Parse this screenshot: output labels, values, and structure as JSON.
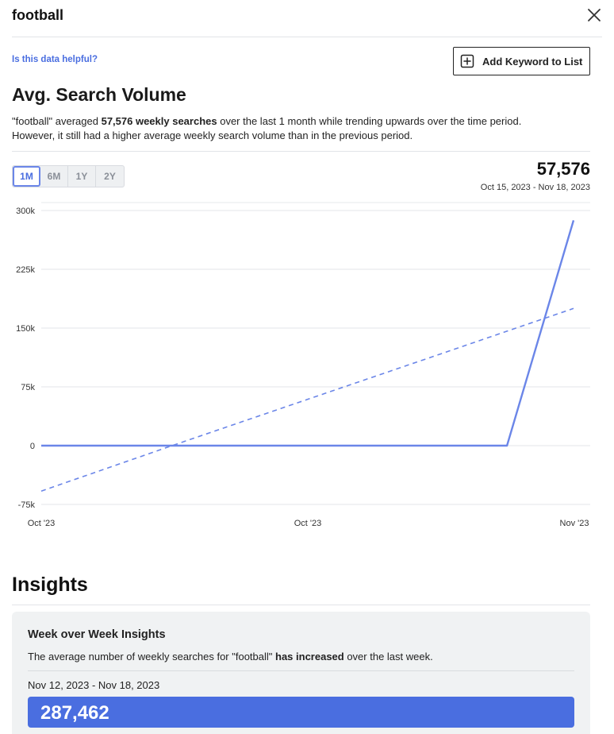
{
  "header": {
    "title": "football"
  },
  "actions": {
    "helpful_link": "Is this data helpful?",
    "add_keyword_label": "Add Keyword to List"
  },
  "volume": {
    "title": "Avg. Search Volume",
    "summary_pre": "\"football\" averaged ",
    "summary_bold": "57,576 weekly searches",
    "summary_post": " over the last 1 month while trending upwards over the time period. However, it still had a higher average weekly search volume than in the previous period.",
    "big_number": "57,576",
    "date_range": "Oct 15, 2023 - Nov 18, 2023",
    "range_tabs": [
      "1M",
      "6M",
      "1Y",
      "2Y"
    ],
    "active_tab": "1M"
  },
  "chart_data": {
    "type": "line",
    "y_ticks": [
      300000,
      225000,
      150000,
      75000,
      0,
      -75000
    ],
    "y_tick_labels": [
      "300k",
      "225k",
      "150k",
      "75k",
      "0",
      "-75k"
    ],
    "ylim": [
      -75000,
      300000
    ],
    "x_tick_labels": [
      "Oct '23",
      "Oct '23",
      "Nov '23"
    ],
    "series": [
      {
        "values": [
          0,
          0,
          0,
          0,
          0,
          0,
          0,
          0,
          287462
        ],
        "style": "solid",
        "color": "#6b86e8"
      },
      {
        "values": [
          -58000,
          -28500,
          1000,
          30000,
          59000,
          88000,
          117000,
          146000,
          175000
        ],
        "style": "dashed",
        "color": "#6b86e8"
      }
    ],
    "grid": true
  },
  "insights": {
    "title": "Insights",
    "card_title": "Week over Week Insights",
    "card_text_pre": "The average number of weekly searches for \"football\" ",
    "card_text_bold": "has increased",
    "card_text_post": " over the last week.",
    "card_date": "Nov 12, 2023 - Nov 18, 2023",
    "card_value": "287,462"
  }
}
